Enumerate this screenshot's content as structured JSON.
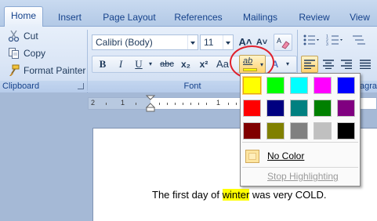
{
  "tabs": [
    "Home",
    "Insert",
    "Page Layout",
    "References",
    "Mailings",
    "Review",
    "View"
  ],
  "clipboard": {
    "cut": "Cut",
    "copy": "Copy",
    "format_painter": "Format Painter",
    "group_label": "Clipboard"
  },
  "font": {
    "name": "Calibri (Body)",
    "size": "11",
    "group_label": "Font",
    "bold": "B",
    "italic": "I",
    "underline": "U",
    "strikethrough": "abc",
    "subscript": "x₂",
    "superscript": "x²",
    "change_case": "Aa",
    "grow_font": "A˄",
    "shrink_font": "A˅",
    "highlight_icon_text": "ab"
  },
  "paragraph": {
    "group_label_partial": "agra"
  },
  "ruler": {
    "labels": [
      "2",
      "1",
      "1"
    ]
  },
  "highlight_menu": {
    "colors": [
      [
        "#ffff00",
        "#00ff00",
        "#00ffff",
        "#ff00ff",
        "#0000ff"
      ],
      [
        "#ff0000",
        "#000080",
        "#008080",
        "#008000",
        "#800080"
      ],
      [
        "#800000",
        "#808000",
        "#808080",
        "#c0c0c0",
        "#000000"
      ]
    ],
    "selected_color": "#ffff00",
    "no_color": "No Color",
    "stop_highlighting": "Stop Highlighting"
  },
  "document": {
    "before": "The first day of ",
    "highlighted": "winter",
    "after": " was very COLD."
  },
  "colors": {
    "highlight": "#ffff00",
    "annotation_circle": "#e0202c"
  }
}
